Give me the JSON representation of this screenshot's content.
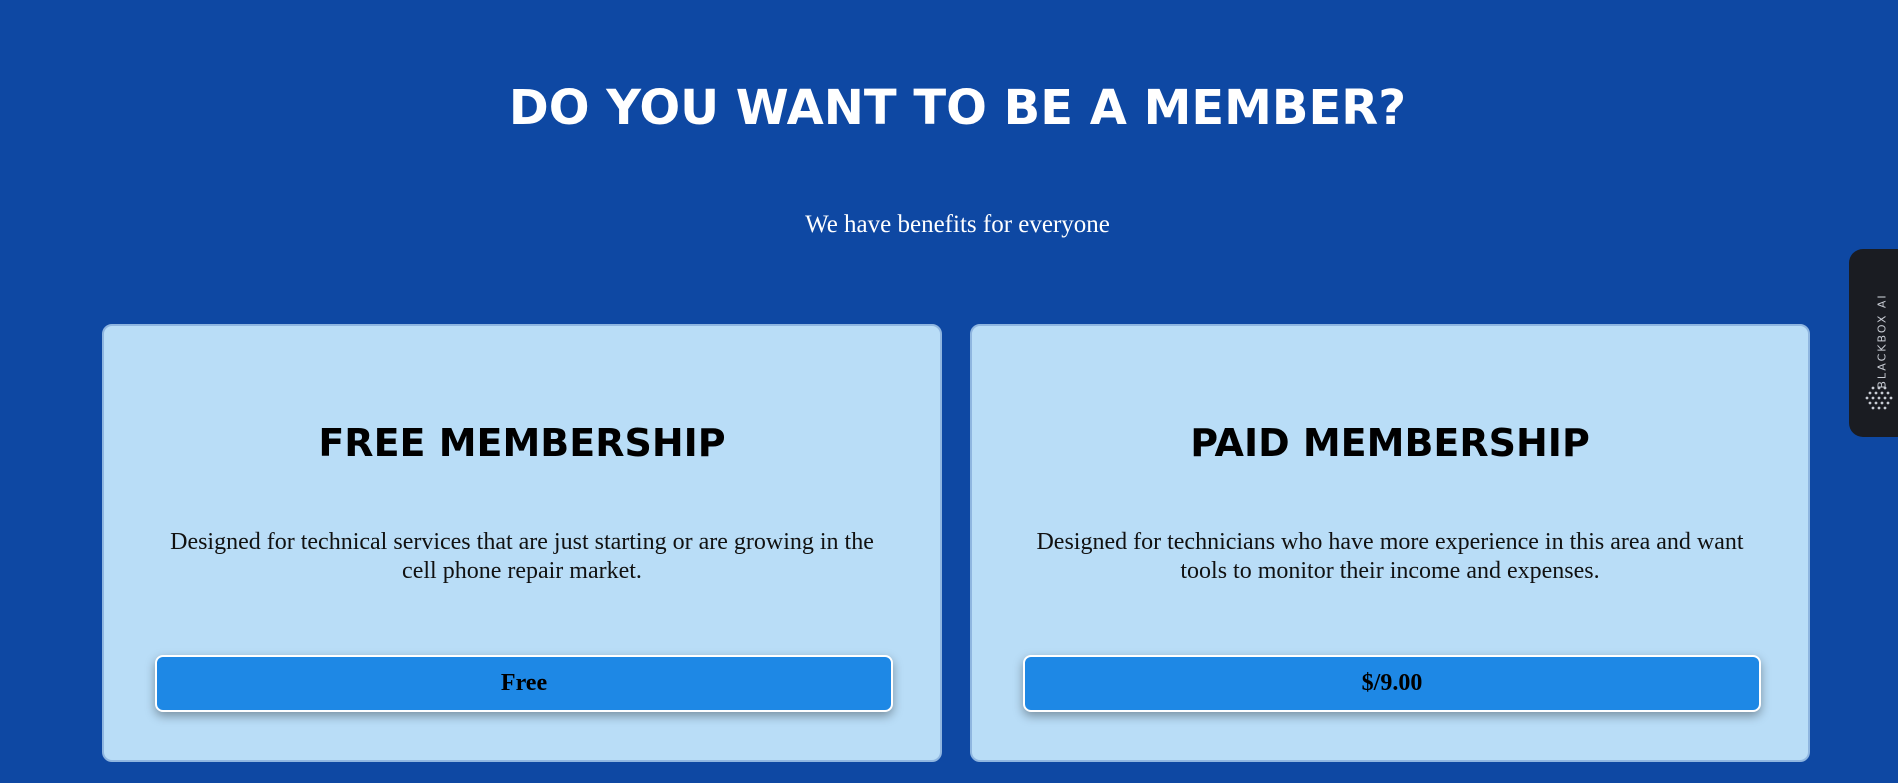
{
  "header": {
    "title": "DO YOU WANT TO BE A MEMBER?",
    "subtitle": "We have benefits for everyone"
  },
  "plans": [
    {
      "title": "FREE MEMBERSHIP",
      "description": "Designed for technical services that are just starting or are growing in the cell phone repair market.",
      "button_label": "Free"
    },
    {
      "title": "PAID MEMBERSHIP",
      "description": "Designed for technicians who have more experience in this area and want tools to monitor their income and expenses.",
      "button_label": "$/9.00"
    }
  ],
  "side_widget": {
    "label": "BLACKBOX AI",
    "icon": "blackbox-dots-icon"
  },
  "colors": {
    "page_background": "#0e48a3",
    "card_background": "#b9ddf7",
    "button_background": "#1e88e5",
    "widget_background": "#1a1c22"
  }
}
